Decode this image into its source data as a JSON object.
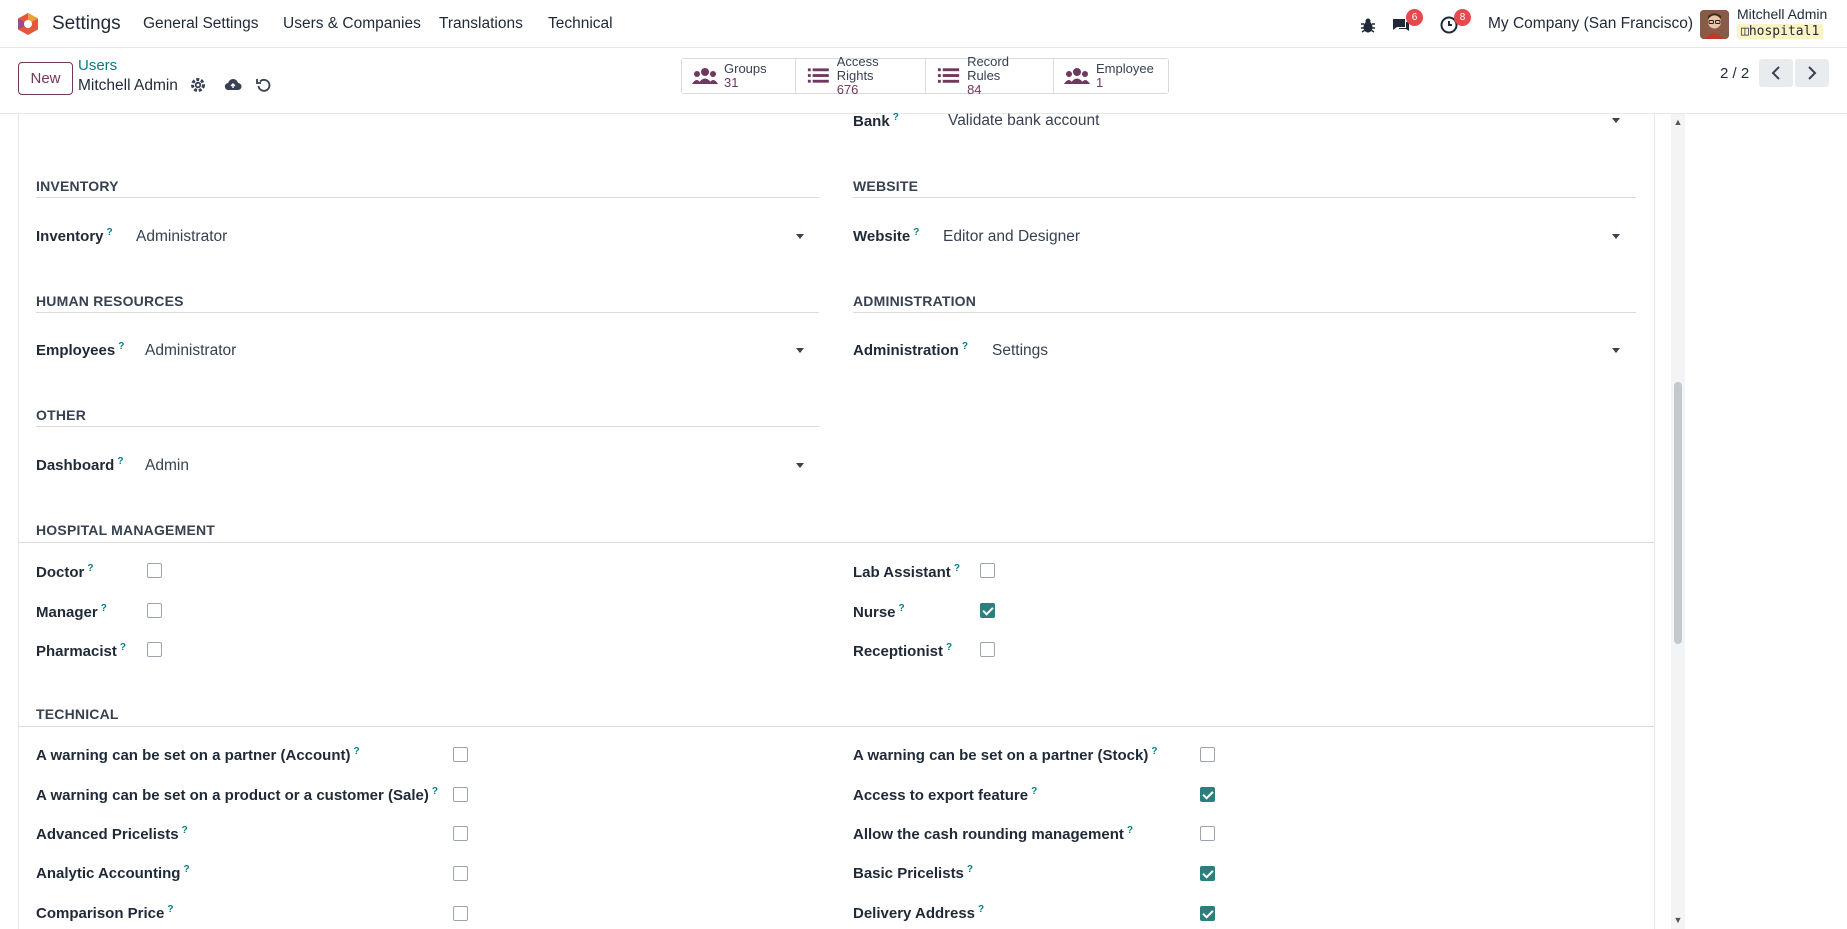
{
  "navbar": {
    "app_name": "Settings",
    "menu": [
      "General Settings",
      "Users & Companies",
      "Translations",
      "Technical"
    ],
    "messages_count": "6",
    "activities_count": "8",
    "company": "My Company (San Francisco)",
    "user_name": "Mitchell Admin",
    "db_name": "hospital1"
  },
  "control": {
    "new_label": "New",
    "breadcrumb": "Users",
    "record_name": "Mitchell Admin",
    "pager": "2 / 2",
    "smart_buttons": [
      {
        "label": "Groups",
        "value": "31"
      },
      {
        "label": "Access Rights",
        "value": "676"
      },
      {
        "label": "Record Rules",
        "value": "84"
      },
      {
        "label": "Employee",
        "value": "1"
      }
    ]
  },
  "form": {
    "bank": {
      "label": "Bank",
      "value": "Validate bank account"
    },
    "inventory_section": "INVENTORY",
    "inventory": {
      "label": "Inventory",
      "value": "Administrator"
    },
    "website_section": "WEBSITE",
    "website": {
      "label": "Website",
      "value": "Editor and Designer"
    },
    "hr_section": "HUMAN RESOURCES",
    "employees": {
      "label": "Employees",
      "value": "Administrator"
    },
    "admin_section": "ADMINISTRATION",
    "administration": {
      "label": "Administration",
      "value": "Settings"
    },
    "other_section": "OTHER",
    "dashboard": {
      "label": "Dashboard",
      "value": "Admin"
    },
    "hospital_section": "HOSPITAL MANAGEMENT",
    "hospital": [
      {
        "label": "Doctor",
        "checked": false
      },
      {
        "label": "Lab Assistant",
        "checked": false
      },
      {
        "label": "Manager",
        "checked": false
      },
      {
        "label": "Nurse",
        "checked": true
      },
      {
        "label": "Pharmacist",
        "checked": false
      },
      {
        "label": "Receptionist",
        "checked": false
      }
    ],
    "technical_section": "TECHNICAL",
    "technical": [
      {
        "label": "A warning can be set on a partner (Account)",
        "checked": false
      },
      {
        "label": "A warning can be set on a partner (Stock)",
        "checked": false
      },
      {
        "label": "A warning can be set on a product or a customer (Sale)",
        "checked": false
      },
      {
        "label": "Access to export feature",
        "checked": true
      },
      {
        "label": "Advanced Pricelists",
        "checked": false
      },
      {
        "label": "Allow the cash rounding management",
        "checked": false
      },
      {
        "label": "Analytic Accounting",
        "checked": false
      },
      {
        "label": "Basic Pricelists",
        "checked": true
      },
      {
        "label": "Comparison Price",
        "checked": false
      },
      {
        "label": "Delivery Address",
        "checked": true
      }
    ]
  },
  "colors": {
    "brand": "#71385f",
    "link": "#017e84",
    "checkbox": "#2d7f7d"
  },
  "help_mark": "?"
}
